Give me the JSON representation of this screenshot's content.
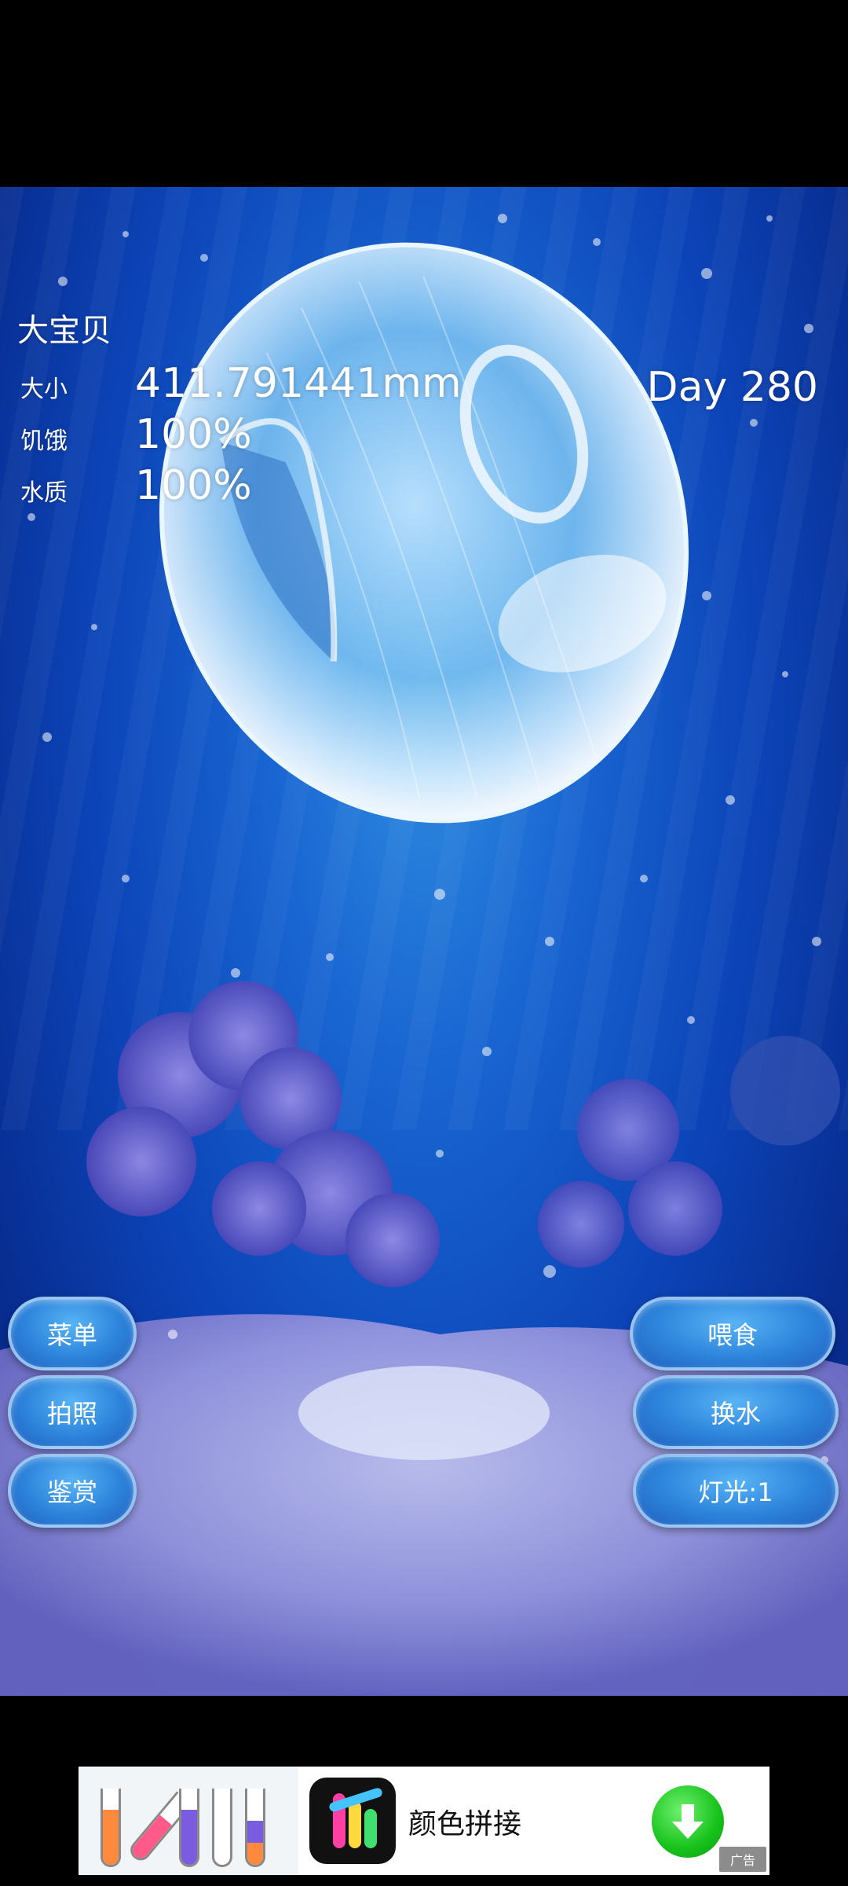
{
  "stats": {
    "pet_name": "大宝贝",
    "size_label": "大小",
    "size_value": "411.791441mm",
    "hunger_label": "饥饿",
    "hunger_value": "100%",
    "water_label": "水质",
    "water_value": "100%",
    "day": "Day 280"
  },
  "buttons": {
    "menu": "菜单",
    "photo": "拍照",
    "appreciate": "鉴赏",
    "feed": "喂食",
    "change_water": "换水",
    "light": "灯光:1"
  },
  "ad": {
    "title": "颜色拼接",
    "badge": "广告",
    "icon": "download-arrow-icon"
  },
  "colors": {
    "scene_blue": "#1966d2",
    "button_blue": "#2d84db",
    "download_green": "#17c21b"
  }
}
